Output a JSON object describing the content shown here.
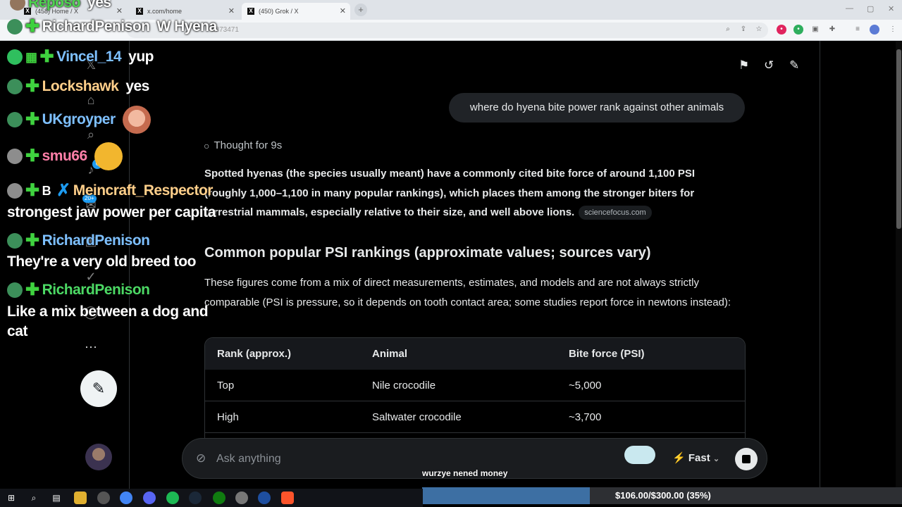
{
  "browser": {
    "tabs": [
      {
        "title": "(458) Home / X",
        "active": false
      },
      {
        "title": "x.com/home",
        "active": false
      },
      {
        "title": "(450) Grok / X",
        "active": true
      }
    ],
    "url_fragment": "2873471"
  },
  "chat": {
    "top_partial": {
      "user": "Reposo",
      "message": "yes"
    },
    "lines": [
      {
        "user": "RichardPenison",
        "message": "W Hyena",
        "user_color": "#ffffff"
      },
      {
        "user": "Vincel_14",
        "message": "yup",
        "user_color": "#7ec0ff"
      },
      {
        "user": "Lockshawk",
        "message": "yes",
        "user_color": "#ffcf8a"
      },
      {
        "user": "UKgroyper",
        "message": "",
        "user_color": "#7ec0ff"
      },
      {
        "user": "smu66",
        "message": "",
        "user_color": "#ff7fa8"
      },
      {
        "user": "Meincraft_Respector",
        "message": "strongest jaw power per capita",
        "user_color": "#ffcf8a"
      },
      {
        "user": "RichardPenison",
        "message": "They're a very old breed too",
        "user_color": "#7ec0ff"
      },
      {
        "user": "RichardPenison",
        "message": "Like a mix between a dog and cat",
        "user_color": "#4cd964"
      }
    ],
    "broken_img_text": "B"
  },
  "nav": {
    "badge_notifications": "6",
    "badge_messages": "20+"
  },
  "grok": {
    "user_question": "where do hyena bite power rank against other animals",
    "thought_label": "Thought for 9s",
    "paragraph1": "Spotted hyenas (the species usually meant) have a commonly cited bite force of around 1,100 PSI (roughly 1,000–1,100 in many popular rankings), which places them among the stronger biters for terrestrial mammals, especially relative to their size, and well above lions.",
    "source_chip": "sciencefocus.com",
    "heading": "Common popular PSI rankings (approximate values; sources vary)",
    "paragraph2": "These figures come from a mix of direct measurements, estimates, and models and are not always strictly comparable (PSI is pressure, so it depends on tooth contact area; some studies report force in newtons instead):",
    "table": {
      "headers": [
        "Rank (approx.)",
        "Animal",
        "Bite force (PSI)"
      ],
      "rows": [
        [
          "Top",
          "Nile crocodile",
          "~5,000"
        ],
        [
          "High",
          "Saltwater crocodile",
          "~3,700"
        ]
      ]
    },
    "input_placeholder": "Ask anything",
    "mode_label": "Fast"
  },
  "donation": {
    "name": "wurzye nened money",
    "goal_text": "$106.00/$300.00 (35%)",
    "progress": 0.35
  }
}
